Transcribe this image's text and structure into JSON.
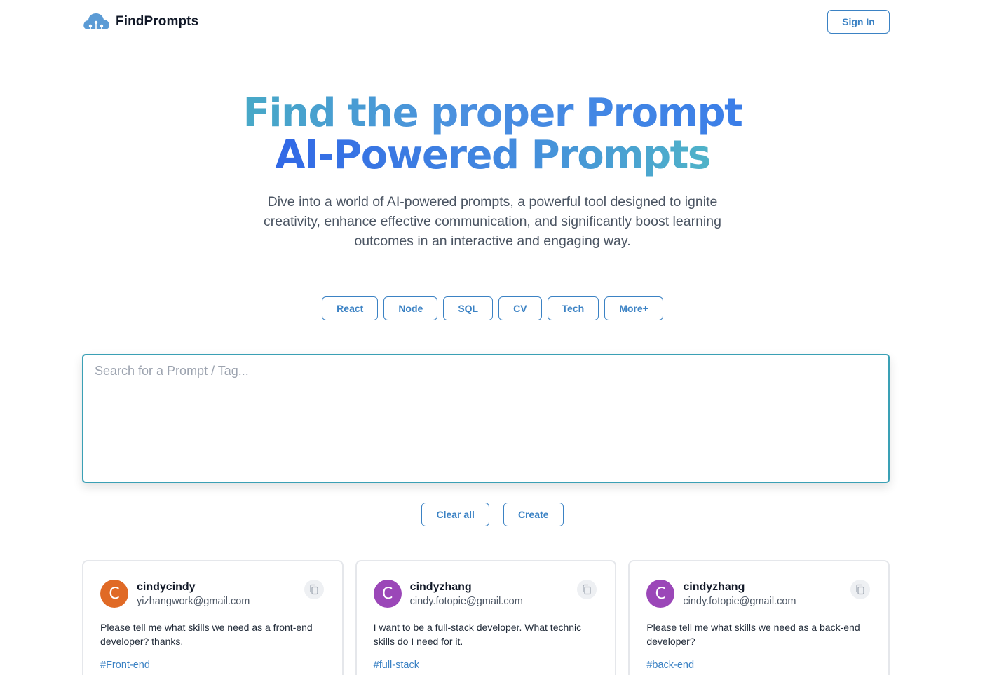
{
  "header": {
    "brand": "FindPrompts",
    "sign_in": "Sign In"
  },
  "hero": {
    "title_line1": "Find the proper Prompt",
    "title_line2": "AI-Powered Prompts",
    "description": "Dive into a world of AI-powered prompts, a powerful tool designed to ignite creativity, enhance effective communication, and significantly boost learning outcomes in an interactive and engaging way."
  },
  "tags": [
    "React",
    "Node",
    "SQL",
    "CV",
    "Tech",
    "More+"
  ],
  "search": {
    "placeholder": "Search for a Prompt / Tag...",
    "value": ""
  },
  "actions": {
    "clear": "Clear all",
    "create": "Create"
  },
  "prompts": [
    {
      "avatar": "C",
      "avatar_color": "#e06a26",
      "username": "cindycindy",
      "email": "yizhangwork@gmail.com",
      "text": "Please tell me what skills we need as a front-end developer? thanks.",
      "tag": "#Front-end"
    },
    {
      "avatar": "C",
      "avatar_color": "#9b47b8",
      "username": "cindyzhang",
      "email": "cindy.fotopie@gmail.com",
      "text": "I want to be a full-stack developer. What technic skills do I need for it.",
      "tag": "#full-stack"
    },
    {
      "avatar": "C",
      "avatar_color": "#9b47b8",
      "username": "cindyzhang",
      "email": "cindy.fotopie@gmail.com",
      "text": "Please tell me what skills we need as a back-end developer?",
      "tag": "#back-end"
    }
  ],
  "colors": {
    "accent": "#3b82c4",
    "search_border": "#3aa0b5"
  },
  "icons": {
    "logo": "cloud-network-icon",
    "copy": "copy-icon"
  }
}
